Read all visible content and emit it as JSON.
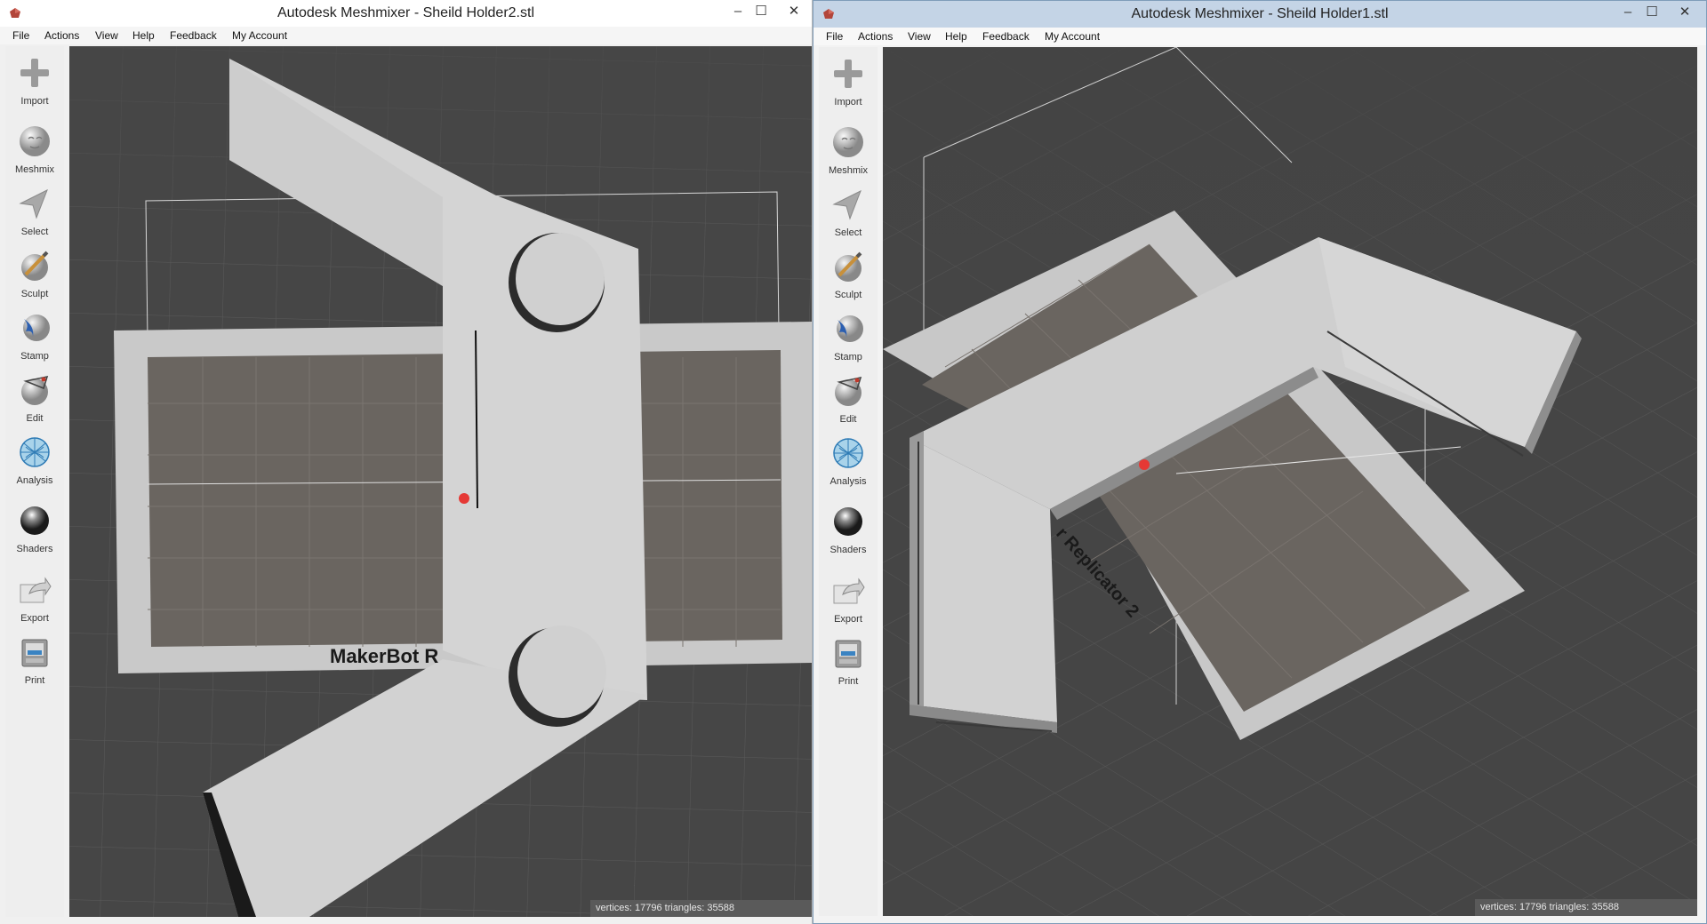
{
  "left_window": {
    "title": "Autodesk Meshmixer - Sheild Holder2.stl",
    "controls": {
      "minimize": "–",
      "maximize": "☐",
      "close": "✕"
    },
    "menu": [
      "File",
      "Actions",
      "View",
      "Help",
      "Feedback",
      "My Account"
    ],
    "toolbar": [
      "Import",
      "Meshmix",
      "Select",
      "Sculpt",
      "Stamp",
      "Edit",
      "Analysis",
      "Shaders",
      "Export",
      "Print"
    ],
    "scene_label": "MakerBot R",
    "status": "vertices: 17796 triangles: 35588"
  },
  "right_window": {
    "title": "Autodesk Meshmixer - Sheild Holder1.stl",
    "controls": {
      "minimize": "–",
      "maximize": "☐",
      "close": "✕"
    },
    "menu": [
      "File",
      "Actions",
      "View",
      "Help",
      "Feedback",
      "My Account"
    ],
    "toolbar": [
      "Import",
      "Meshmix",
      "Select",
      "Sculpt",
      "Stamp",
      "Edit",
      "Analysis",
      "Shaders",
      "Export",
      "Print"
    ],
    "scene_label": "r Replicator 2",
    "status": "vertices: 17796 triangles: 35588"
  },
  "icons": {
    "tools": [
      "plus-icon",
      "head-icon",
      "arrow-icon",
      "brush-icon",
      "stamp-icon",
      "edit-icon",
      "analysis-icon",
      "sphere-icon",
      "export-icon",
      "printer-icon"
    ]
  },
  "colors": {
    "viewport_bg": "#464646",
    "model": "#cfcfcf",
    "build_plate": "#6a6560",
    "pivot_marker": "#e53935",
    "active_titlebar": "#c4d4e6"
  }
}
